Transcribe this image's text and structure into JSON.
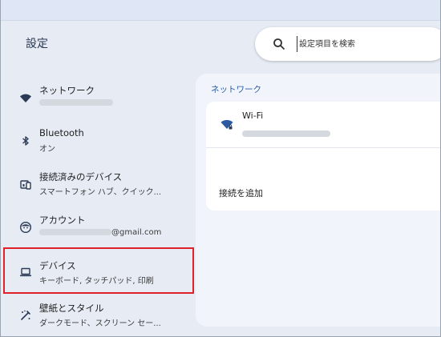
{
  "app": {
    "title": "設定"
  },
  "search": {
    "placeholder": "設定項目を検索",
    "icon": "search-icon"
  },
  "sidebar": {
    "items": [
      {
        "id": "network",
        "icon": "wifi-icon",
        "label": "ネットワーク",
        "sub": ""
      },
      {
        "id": "bluetooth",
        "icon": "bluetooth-icon",
        "label": "Bluetooth",
        "sub": "オン"
      },
      {
        "id": "connected-devices",
        "icon": "connected-devices-icon",
        "label": "接続済みのデバイス",
        "sub": "スマートフォン ハブ、クイック..."
      },
      {
        "id": "account",
        "icon": "account-icon",
        "label": "アカウント",
        "sub": "@gmail.com"
      },
      {
        "id": "device",
        "icon": "laptop-icon",
        "label": "デバイス",
        "sub": "キーボード, タッチパッド, 印刷"
      },
      {
        "id": "wallpaper",
        "icon": "palette-icon",
        "label": "壁紙とスタイル",
        "sub": "ダークモード、スクリーン セー..."
      }
    ],
    "selected": "device"
  },
  "main": {
    "section_title": "ネットワーク",
    "wifi": {
      "name": "Wi-Fi"
    },
    "add_connection": "接続を追加"
  },
  "colors": {
    "background": "#e6ebf4",
    "panel": "#f1f4fa",
    "accent": "#2a5aa0",
    "highlight": "#e0202a"
  }
}
